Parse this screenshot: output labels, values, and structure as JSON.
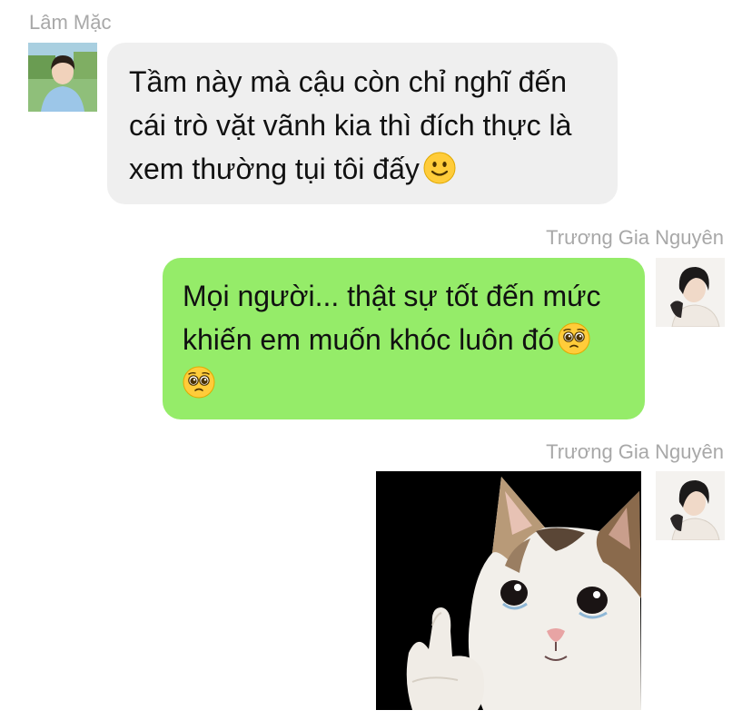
{
  "messages": [
    {
      "sender": "Lâm Mặc",
      "side": "left",
      "text": "Tầm này mà cậu còn chỉ nghĩ đến cái trò vặt vãnh kia thì đích thực là xem thường tụi tôi đấy",
      "emoji": "slightly-smiling-face-emoji"
    },
    {
      "sender": "Trương Gia Nguyên",
      "side": "right",
      "text": "Mọi người... thật sự tốt đến mức khiến em muốn khóc luôn đó",
      "emoji": "pleading-face-emoji"
    },
    {
      "sender": "Trương Gia Nguyên",
      "side": "right",
      "sticker": "crying-cat-thumbs-up-sticker"
    }
  ],
  "colors": {
    "incoming_bubble": "#efefef",
    "outgoing_bubble": "#95ec69",
    "sender_name": "#a8a8a8",
    "text": "#111111"
  }
}
